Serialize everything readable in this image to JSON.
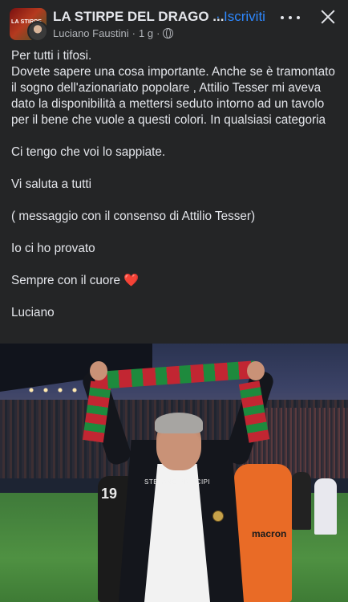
{
  "header": {
    "group_name": "LA STIRPE DEL DRAGO ...",
    "separator": "·",
    "join_label": "Iscriviti",
    "author": "Luciano Faustini",
    "time": "1 g",
    "meta_separator": "·",
    "avatar_text": "LA STIRPE",
    "audience_icon": "globe-icon",
    "more_icon": "more-icon",
    "close_icon": "close-icon"
  },
  "post": {
    "paragraphs": [
      "Per tutti i tifosi.",
      "Dovete sapere una cosa importante.  Anche se è tramontato il sogno dell'azionariato popolare , Attilio Tesser mi aveva dato la disponibilità a mettersi seduto intorno ad un tavolo per il bene che vuole a questi colori.  In qualsiasi categoria",
      "Ci tengo che voi lo sappiate.",
      "Vi saluta a tutti",
      "( messaggio con il consenso di Attilio Tesser)",
      "Io ci ho provato",
      "Sempre con il cuore",
      "Luciano"
    ],
    "heart": "❤️"
  },
  "photo": {
    "watermark": "STEFANO PRINCIPI",
    "jersey_number": "19",
    "kit_brand": "macron"
  },
  "colors": {
    "background": "#242526",
    "text": "#e4e6eb",
    "secondary_text": "#b0b3b8",
    "link_blue": "#2d88ff"
  }
}
